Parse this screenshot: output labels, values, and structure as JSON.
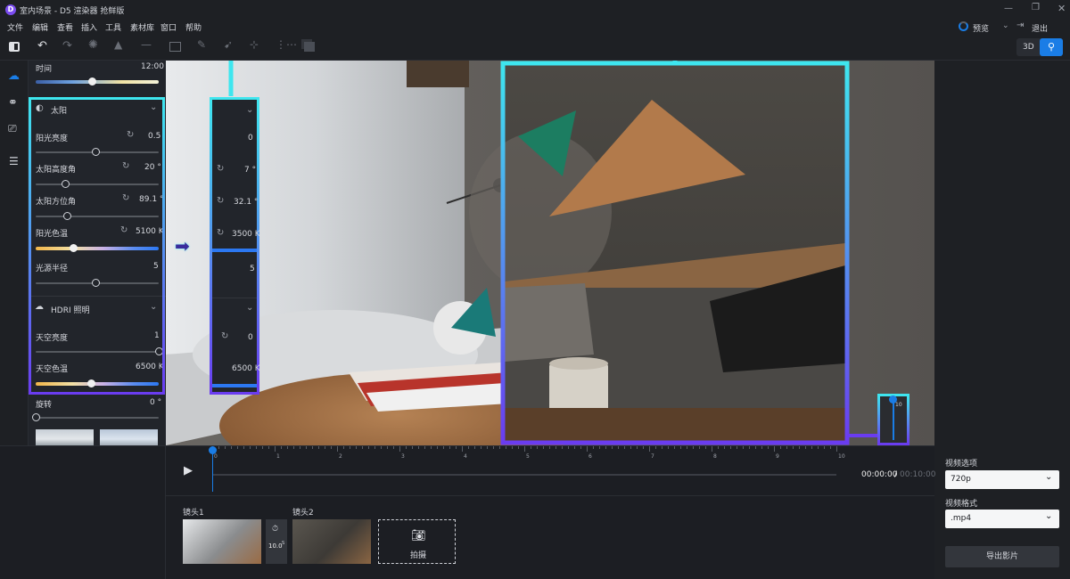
{
  "window": {
    "title": "室内场景 - D5 渲染器 抢鲜版"
  },
  "menu": [
    "文件",
    "编辑",
    "查看",
    "插入",
    "工具",
    "素材库",
    "窗口",
    "帮助"
  ],
  "topright": {
    "preview": "预览",
    "exit": "退出",
    "view3d": "3D"
  },
  "panel": {
    "time_label": "时间",
    "time_value": "12:00",
    "time_frac": 0.46,
    "sun_title": "太阳",
    "sun_brightness_label": "阳光亮度",
    "sun_brightness_value": "0.5",
    "sun_brightness_frac": 0.49,
    "sun_altitude_label": "太阳高度角",
    "sun_altitude_value": "20 °",
    "sun_altitude_frac": 0.24,
    "sun_azimuth_label": "太阳方位角",
    "sun_azimuth_value": "89.1 °",
    "sun_azimuth_frac": 0.26,
    "sun_temp_label": "阳光色温",
    "sun_temp_value": "5100 K",
    "sun_temp_frac": 0.31,
    "light_radius_label": "光源半径",
    "light_radius_value": "5",
    "light_radius_frac": 0.49,
    "hdri_title": "HDRI 照明",
    "sky_brightness_label": "天空亮度",
    "sky_brightness_value": "1",
    "sky_brightness_frac": 1.0,
    "sky_temp_label": "天空色温",
    "sky_temp_value": "6500 K",
    "sky_temp_frac": 0.45,
    "rotate_label": "旋转",
    "rotate_value": "0 °",
    "rotate_frac": 0.0
  },
  "callout_panel": {
    "v1": "0",
    "v2": "7 °",
    "v3": "32.1 °",
    "v4": "3500 K",
    "v5": "5",
    "v6": "0",
    "v7": "6500 K"
  },
  "mini_slider": {
    "value": "10"
  },
  "timeline": {
    "ticks": [
      "0",
      "1",
      "2",
      "3",
      "4",
      "5",
      "6",
      "7",
      "8",
      "9",
      "10"
    ],
    "current_time": "00:00:00",
    "separator": "/",
    "total_time": "00:10:00"
  },
  "clips": {
    "clip1_label": "镜头1",
    "clip2_label": "镜头2",
    "duration": "10.0",
    "duration_unit": "S",
    "capture_label": "拍摄"
  },
  "right": {
    "video_options_label": "视频选项",
    "resolution_value": "720p",
    "format_label": "视频格式",
    "format_value": ".mp4",
    "export_label": "导出影片"
  },
  "colors": {
    "accent": "#1a7de6",
    "callout_cyan": "#3ee6ef",
    "callout_purple": "#6a3cf0"
  }
}
